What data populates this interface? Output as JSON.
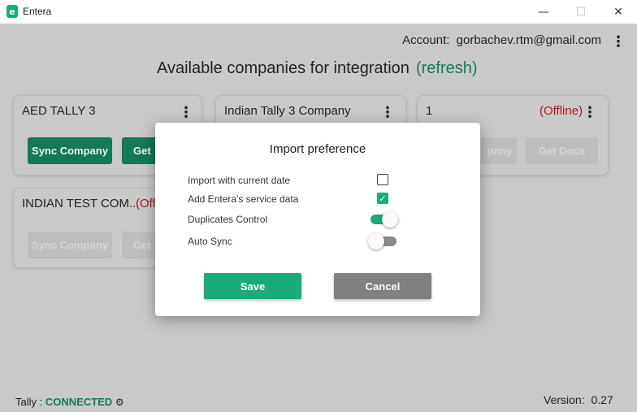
{
  "window": {
    "title": "Entera",
    "logo_letter": "e",
    "min_glyph": "—",
    "max_glyph": "☐",
    "close_glyph": "✕"
  },
  "header": {
    "account_label": "Account:",
    "account_email": "gorbachev.rtm@gmail.com",
    "menu_glyph": "⋮"
  },
  "main": {
    "heading": "Available companies for integration",
    "refresh_label": "(refresh)"
  },
  "companies": [
    {
      "name": "AED TALLY 3",
      "status": "",
      "sync_label": "Sync Company",
      "docs_label": "Get"
    },
    {
      "name": "Indian Tally 3 Company",
      "status": ""
    },
    {
      "name": "1",
      "status": "(Offline)",
      "sync_label": "pany",
      "docs_label": "Get Docs"
    },
    {
      "name": "INDIAN TEST COM...",
      "status": "(Off",
      "sync_label": "Sync Company",
      "docs_label": "Get"
    }
  ],
  "footer": {
    "tally_label": "Tally :",
    "tally_status": "CONNECTED",
    "settings_glyph": "⚙",
    "version_label": "Version:",
    "version_value": "0.27"
  },
  "modal": {
    "title": "Import preference",
    "options": [
      {
        "label": "Import with current date",
        "type": "checkbox",
        "checked": false
      },
      {
        "label": "Add Entera's service data",
        "type": "checkbox",
        "checked": true,
        "check_glyph": "✓"
      },
      {
        "label": "Duplicates Control",
        "type": "toggle",
        "on": true
      },
      {
        "label": "Auto Sync",
        "type": "toggle",
        "on": false
      }
    ],
    "save_label": "Save",
    "cancel_label": "Cancel"
  },
  "colors": {
    "accent": "#1aab7a",
    "dark_green": "#127a55",
    "offline": "#a31c1c",
    "cancel": "#808080"
  }
}
